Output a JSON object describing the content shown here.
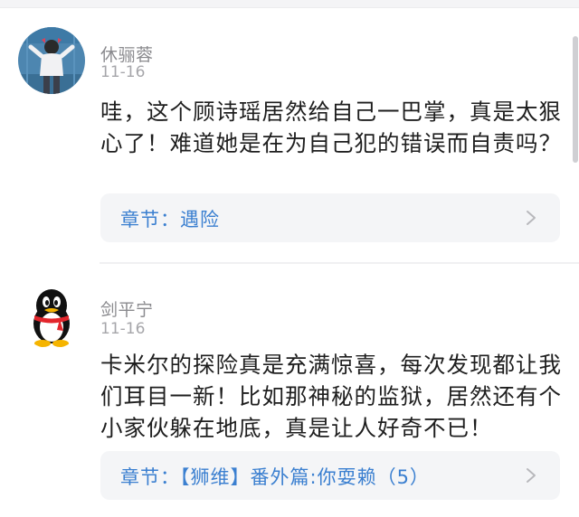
{
  "comments": [
    {
      "username": "休骊蓉",
      "date": "11-16",
      "text": "哇，这个顾诗瑶居然给自己一巴掌，真是太狠心了！难道她是在为自己犯的错误而自责吗？",
      "chapter": "章节：遇险"
    },
    {
      "username": "剑平宁",
      "date": "11-16",
      "text": "卡米尔的探险真是充满惊喜，每次发现都让我们耳目一新！比如那神秘的监狱，居然还有个小家伙躲在地底，真是让人好奇不已！",
      "chapter": "章节：【狮维】番外篇:你耍赖（5）"
    }
  ],
  "icons": {
    "chapter_arrow": "chevron-right-icon"
  },
  "colors": {
    "link": "#3a7fd0",
    "card_bg": "#f4f5f7",
    "meta": "#8a8a8e"
  }
}
